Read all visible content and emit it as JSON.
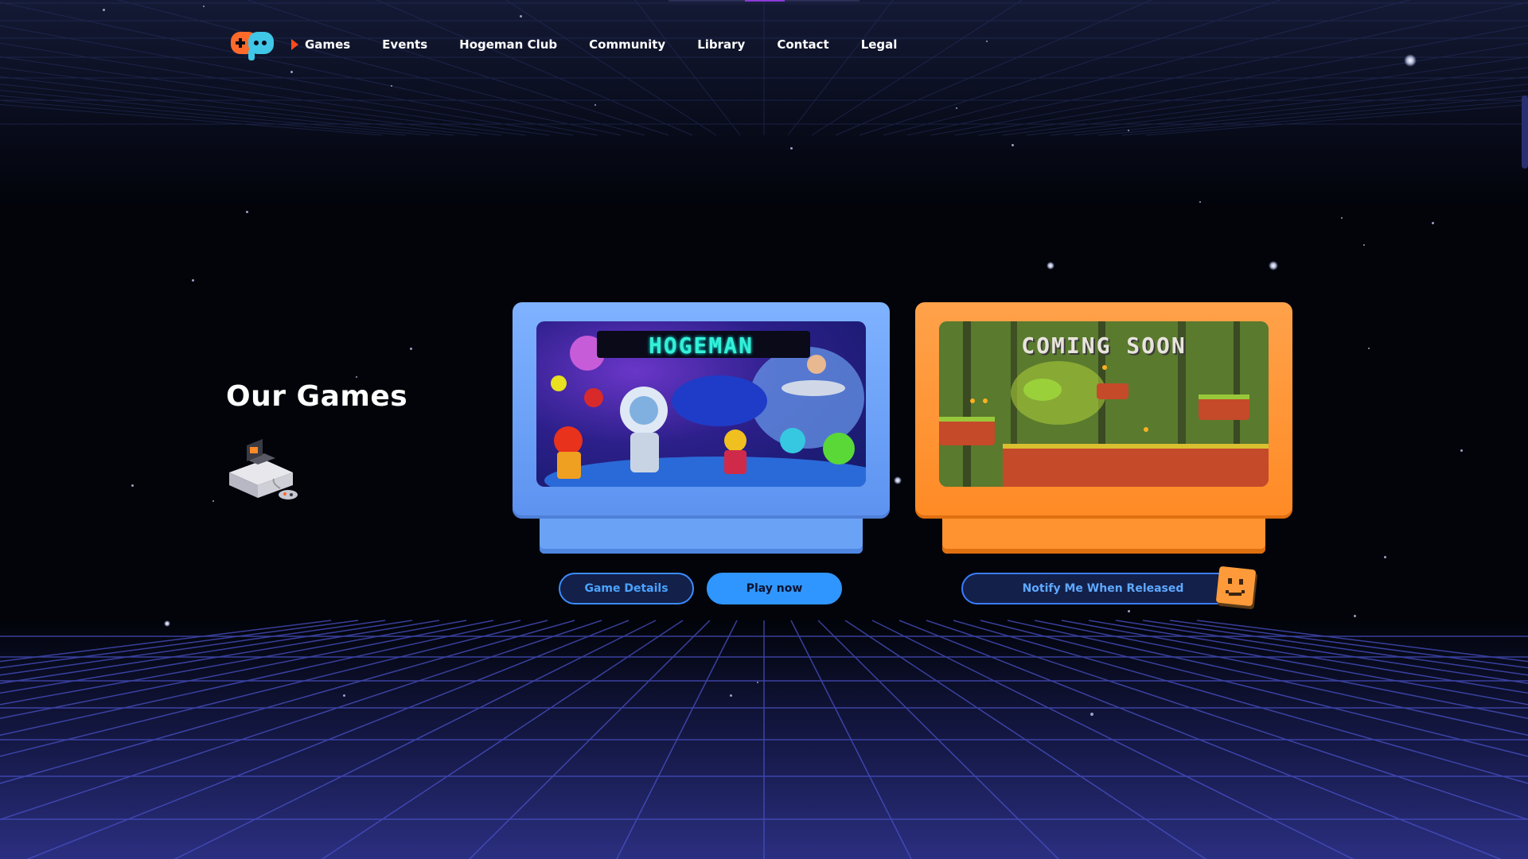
{
  "nav": {
    "logo_icon": "gamepad-logo-icon",
    "items": [
      {
        "label": "Games",
        "active": true
      },
      {
        "label": "Events",
        "active": false
      },
      {
        "label": "Hogeman Club",
        "active": false
      },
      {
        "label": "Community",
        "active": false
      },
      {
        "label": "Library",
        "active": false
      },
      {
        "label": "Contact",
        "active": false
      },
      {
        "label": "Legal",
        "active": false
      }
    ]
  },
  "section": {
    "title": "Our Games",
    "icon": "retro-console-icon"
  },
  "games": [
    {
      "art_title": "HOGEMAN",
      "cartridge_color": "#6ea6f8",
      "buttons": {
        "details": "Game Details",
        "play": "Play now"
      }
    },
    {
      "art_title": "COMING SOON",
      "cartridge_color": "#ff9330",
      "buttons": {
        "notify": "Notify Me When Released"
      }
    }
  ],
  "colors": {
    "background": "#02040a",
    "accent_orange": "#ff4a1c",
    "button_blue": "#2f96ff",
    "grid": "#4a52c8"
  }
}
